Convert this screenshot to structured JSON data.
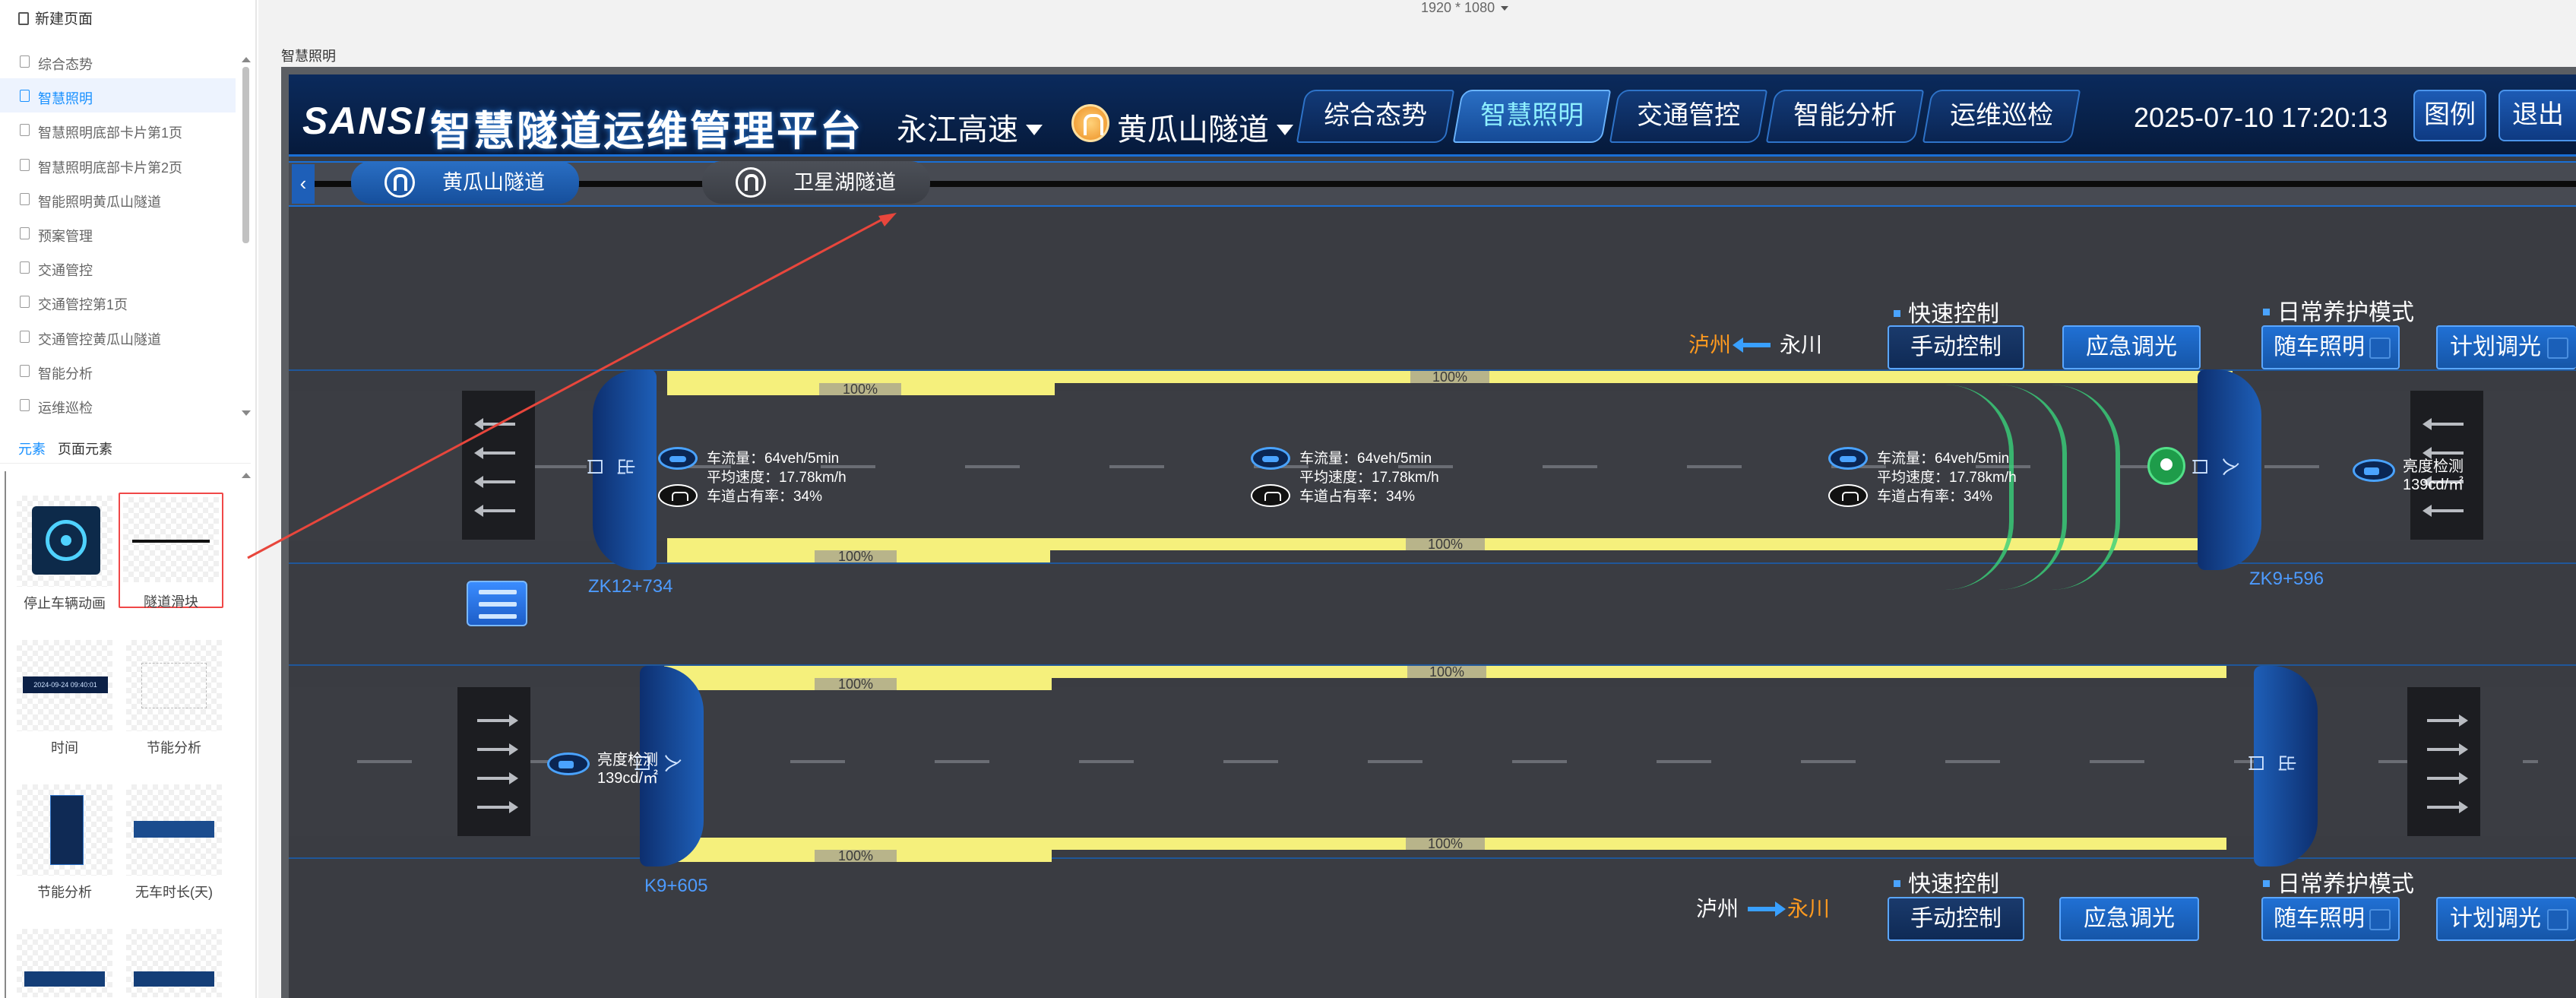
{
  "editor": {
    "new_page": "新建页面",
    "pages": [
      "综合态势",
      "智慧照明",
      "智慧照明底部卡片第1页",
      "智慧照明底部卡片第2页",
      "智能照明黄瓜山隧道",
      "预案管理",
      "交通管控",
      "交通管控第1页",
      "交通管控黄瓜山隧道",
      "智能分析",
      "运维巡检"
    ],
    "active_page": "智慧照明",
    "tabs": {
      "elements": "元素",
      "page_elements": "页面元素"
    },
    "widgets": [
      "停止车辆动画",
      "隧道滑块",
      "时间",
      "节能分析",
      "节能分析",
      "无车时长(天)"
    ],
    "time_widget_text": "2024-09-24 09:40:01"
  },
  "canvas": {
    "resolution": "1920 * 1080",
    "page_title": "智慧照明"
  },
  "dashboard": {
    "logo": "SANSI",
    "title": "智慧隧道运维管理平台",
    "highway": "永江高速",
    "tunnel": "黄瓜山隧道",
    "nav_tabs": [
      "综合态势",
      "智慧照明",
      "交通管控",
      "智能分析",
      "运维巡检"
    ],
    "active_tab": "智慧照明",
    "datetime": "2025-07-10 17:20:13",
    "legend_button": "图例",
    "exit_button": "退出",
    "sub_tabs": [
      "黄瓜山隧道",
      "卫星湖隧道"
    ]
  },
  "road": {
    "upper": {
      "direction_from": "永川",
      "direction_to": "泸州",
      "quick_control_title": "快速控制",
      "daily_mode_title": "日常养护模式",
      "buttons": [
        "手动控制",
        "应急调光",
        "随车照明",
        "计划调光"
      ],
      "stake_left": "ZK12+734",
      "stake_right": "ZK9+596",
      "portal_left": "出口",
      "portal_right": "入口",
      "bar_top_full": "100%",
      "bar_top_short": "100%",
      "bar_bottom_full": "100%",
      "bar_bottom_short": "100%"
    },
    "lower": {
      "direction_from": "泸州",
      "direction_to": "永川",
      "quick_control_title": "快速控制",
      "daily_mode_title": "日常养护模式",
      "buttons": [
        "手动控制",
        "应急调光",
        "随车照明",
        "计划调光"
      ],
      "stake_left": "K9+605",
      "portal_left": "入口",
      "portal_right": "出口",
      "bar_top_full": "100%",
      "bar_top_short": "100%",
      "bar_bottom_full": "100%",
      "bar_bottom_short": "100%"
    },
    "monitors": [
      {
        "flow": "车流量：64veh/5min",
        "speed": "平均速度：17.78km/h",
        "occupancy": "车道占有率：34%"
      },
      {
        "flow": "车流量：64veh/5min",
        "speed": "平均速度：17.78km/h",
        "occupancy": "车道占有率：34%"
      },
      {
        "flow": "车流量：64veh/5min",
        "speed": "平均速度：17.78km/h",
        "occupancy": "车道占有率：34%"
      }
    ],
    "luminance_upper": {
      "label": "亮度检测",
      "value": "139cd/㎡"
    },
    "luminance_lower": {
      "label": "亮度检测",
      "value": "139cd/㎡"
    }
  },
  "colors": {
    "accent": "#1890ff",
    "header_bg": "#082149",
    "yellow_bar": "#f5f07c",
    "annotation": "#e8463c",
    "stake_blue": "#4d9bff",
    "direction_orange": "#ff9a1f"
  }
}
